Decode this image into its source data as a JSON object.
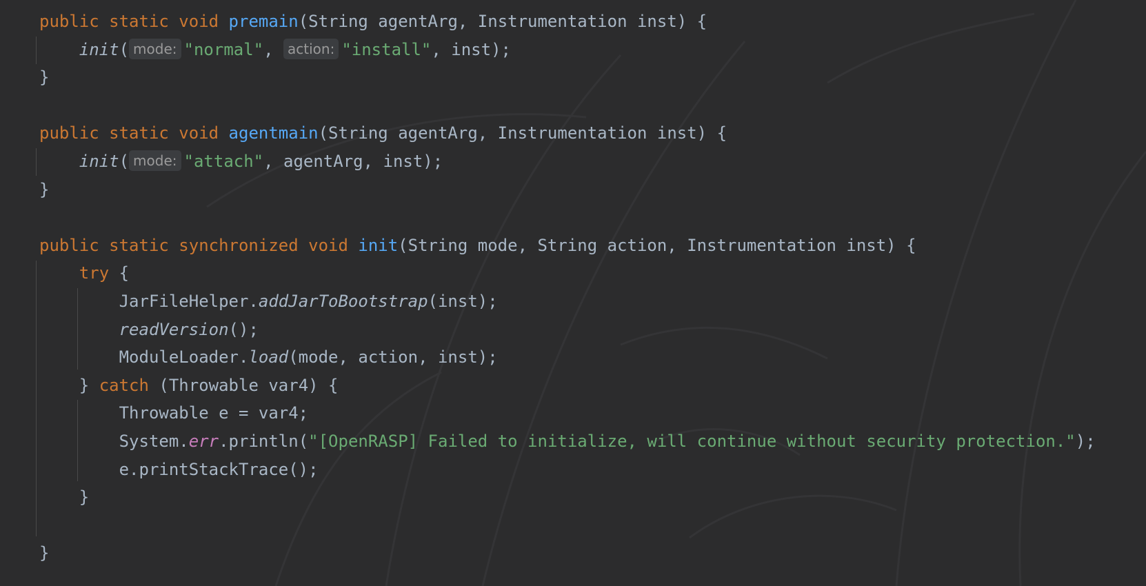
{
  "palette": {
    "background": "#2c2c2d",
    "keyword": "#cc7832",
    "method": "#56a8f5",
    "string": "#6aab73",
    "text": "#a9b7c6",
    "static_field": "#c77dbb",
    "hint_bg": "#3b3d40"
  },
  "code": {
    "l1": {
      "k1": "public static void ",
      "fn": "premain",
      "rest": "(String agentArg, Instrumentation inst) {"
    },
    "l2": {
      "call": "init",
      "open": "(",
      "hint1": "mode:",
      "s1": "\"normal\"",
      "sep": ", ",
      "hint2": "action:",
      "s2": "\"install\"",
      "rest": ", inst);"
    },
    "l3": {
      "brace": "}"
    },
    "l5": {
      "k1": "public static void ",
      "fn": "agentmain",
      "rest": "(String agentArg, Instrumentation inst) {"
    },
    "l6": {
      "call": "init",
      "open": "(",
      "hint1": "mode:",
      "s1": "\"attach\"",
      "rest": ", agentArg, inst);"
    },
    "l7": {
      "brace": "}"
    },
    "l9": {
      "k1": "public static synchronized void ",
      "fn": "init",
      "rest": "(String mode, String action, Instrumentation inst) {"
    },
    "l10": {
      "kw": "try",
      "rest": " {"
    },
    "l11": {
      "cls": "JarFileHelper.",
      "m": "addJarToBootstrap",
      "rest": "(inst);"
    },
    "l12": {
      "m": "readVersion",
      "rest": "();"
    },
    "l13": {
      "cls": "ModuleLoader.",
      "m": "load",
      "rest": "(mode, action, inst);"
    },
    "l14": {
      "pre": "} ",
      "kw": "catch",
      "rest": " (Throwable var4) {"
    },
    "l15": {
      "text": "Throwable e = var4;"
    },
    "l16": {
      "cls": "System.",
      "field": "err",
      "mid": ".println(",
      "str": "\"[OpenRASP] Failed to initialize, will continue without security protection.\"",
      "rest": ");"
    },
    "l17": {
      "text": "e.printStackTrace();"
    },
    "l18": {
      "brace": "}"
    },
    "l20": {
      "brace": "}"
    }
  }
}
